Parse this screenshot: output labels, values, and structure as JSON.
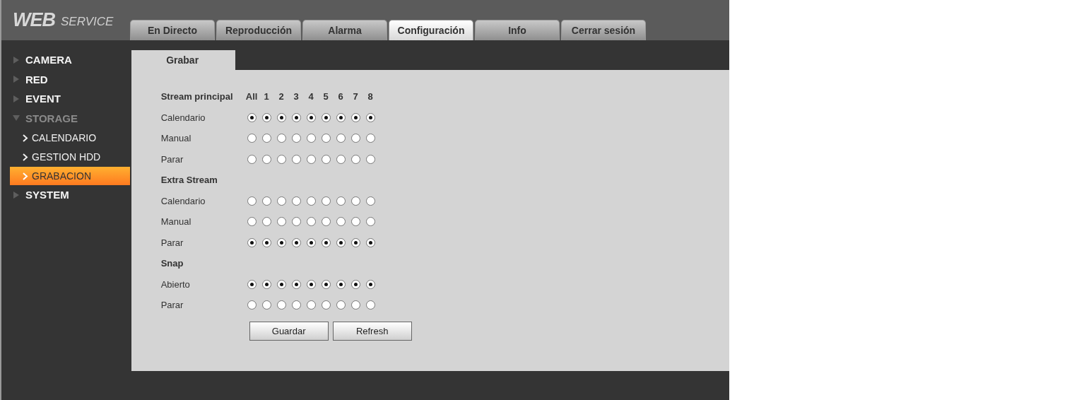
{
  "logo": {
    "main": "WEB",
    "sub": "SERVICE"
  },
  "tabs": [
    {
      "label": "En Directo",
      "selected": false
    },
    {
      "label": "Reproducción",
      "selected": false
    },
    {
      "label": "Alarma",
      "selected": false
    },
    {
      "label": "Configuración",
      "selected": true
    },
    {
      "label": "Info",
      "selected": false
    },
    {
      "label": "Cerrar sesión",
      "selected": false
    }
  ],
  "sidebar": {
    "items": [
      {
        "label": "CAMERA",
        "expanded": false
      },
      {
        "label": "RED",
        "expanded": false
      },
      {
        "label": "EVENT",
        "expanded": false
      },
      {
        "label": "STORAGE",
        "expanded": true,
        "children": [
          {
            "label": "CALENDARIO",
            "selected": false
          },
          {
            "label": "GESTION HDD",
            "selected": false
          },
          {
            "label": "GRABACION",
            "selected": true
          }
        ]
      },
      {
        "label": "SYSTEM",
        "expanded": false
      }
    ]
  },
  "panel_tab": "Grabar",
  "columns": [
    "All",
    "1",
    "2",
    "3",
    "4",
    "5",
    "6",
    "7",
    "8"
  ],
  "groups": [
    {
      "title": "Stream principal",
      "rows": [
        {
          "label": "Calendario",
          "options": [
            {
              "selected": true
            },
            {
              "selected": true
            },
            {
              "selected": true
            },
            {
              "selected": true
            },
            {
              "selected": true
            },
            {
              "selected": true
            },
            {
              "selected": true
            },
            {
              "selected": true
            },
            {
              "selected": true
            }
          ]
        },
        {
          "label": "Manual",
          "options": [
            {
              "selected": false
            },
            {
              "selected": false
            },
            {
              "selected": false
            },
            {
              "selected": false
            },
            {
              "selected": false
            },
            {
              "selected": false
            },
            {
              "selected": false
            },
            {
              "selected": false
            },
            {
              "selected": false
            }
          ]
        },
        {
          "label": "Parar",
          "options": [
            {
              "selected": false
            },
            {
              "selected": false
            },
            {
              "selected": false
            },
            {
              "selected": false
            },
            {
              "selected": false
            },
            {
              "selected": false
            },
            {
              "selected": false
            },
            {
              "selected": false
            },
            {
              "selected": false
            }
          ]
        }
      ]
    },
    {
      "title": "Extra Stream",
      "rows": [
        {
          "label": "Calendario",
          "options": [
            {
              "selected": false
            },
            {
              "selected": false
            },
            {
              "selected": false
            },
            {
              "selected": false
            },
            {
              "selected": false
            },
            {
              "selected": false
            },
            {
              "selected": false
            },
            {
              "selected": false
            },
            {
              "selected": false
            }
          ]
        },
        {
          "label": "Manual",
          "options": [
            {
              "selected": false
            },
            {
              "selected": false
            },
            {
              "selected": false
            },
            {
              "selected": false
            },
            {
              "selected": false
            },
            {
              "selected": false
            },
            {
              "selected": false
            },
            {
              "selected": false
            },
            {
              "selected": false
            }
          ]
        },
        {
          "label": "Parar",
          "options": [
            {
              "selected": true
            },
            {
              "selected": true
            },
            {
              "selected": true
            },
            {
              "selected": true
            },
            {
              "selected": true
            },
            {
              "selected": true
            },
            {
              "selected": true
            },
            {
              "selected": true
            },
            {
              "selected": true
            }
          ]
        }
      ]
    },
    {
      "title": "Snap",
      "rows": [
        {
          "label": "Abierto",
          "options": [
            {
              "selected": true
            },
            {
              "selected": true
            },
            {
              "selected": true
            },
            {
              "selected": true
            },
            {
              "selected": true
            },
            {
              "selected": true
            },
            {
              "selected": true
            },
            {
              "selected": true
            },
            {
              "selected": true
            }
          ]
        },
        {
          "label": "Parar",
          "options": [
            {
              "selected": false
            },
            {
              "selected": false
            },
            {
              "selected": false
            },
            {
              "selected": false
            },
            {
              "selected": false
            },
            {
              "selected": false
            },
            {
              "selected": false
            },
            {
              "selected": false
            },
            {
              "selected": false
            }
          ]
        }
      ]
    }
  ],
  "buttons": [
    "Guardar",
    "Refresh"
  ]
}
